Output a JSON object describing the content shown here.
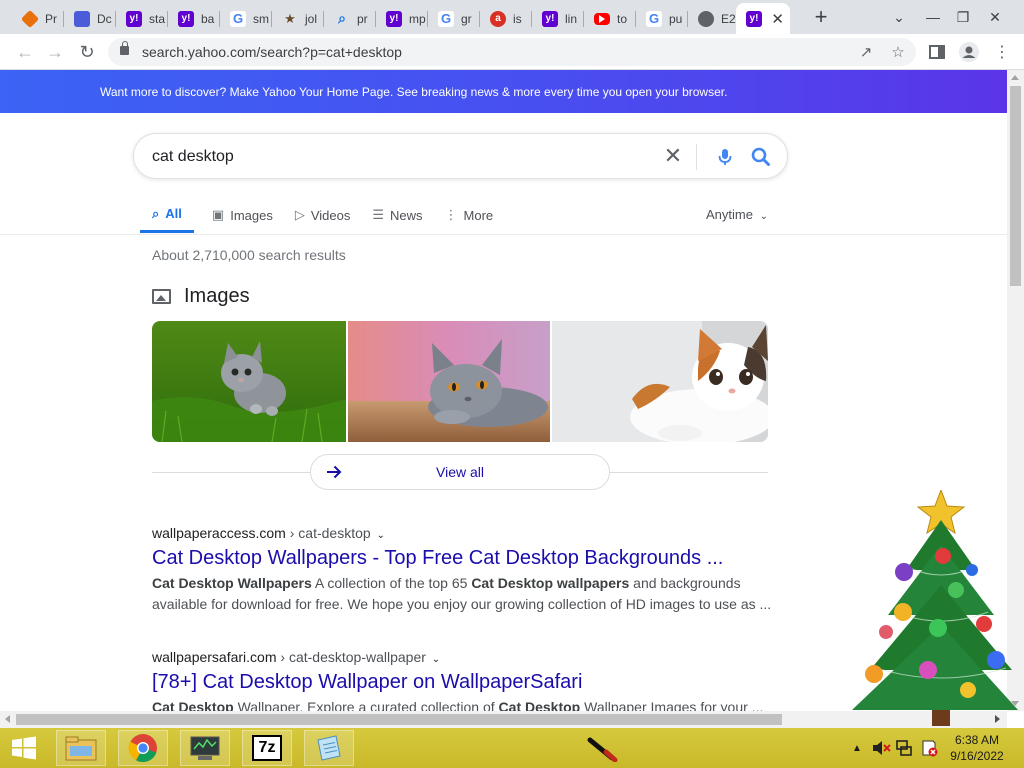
{
  "browser": {
    "tabs": [
      {
        "label": "Pr",
        "favicon": "diamond-icon",
        "color": "#e8710a"
      },
      {
        "label": "Dc",
        "favicon": "doc-icon",
        "color": "#4a5cd8"
      },
      {
        "label": "sta",
        "favicon": "yahoo-icon",
        "color": "#6001d2"
      },
      {
        "label": "ba",
        "favicon": "yahoo-icon",
        "color": "#6001d2"
      },
      {
        "label": "sm",
        "favicon": "google-icon",
        "color": "#4285f4"
      },
      {
        "label": "jol",
        "favicon": "person-icon",
        "color": "#6b4b2b"
      },
      {
        "label": "pr",
        "favicon": "search-icon",
        "color": "#1a73e8"
      },
      {
        "label": "mp",
        "favicon": "yahoo-icon",
        "color": "#6001d2"
      },
      {
        "label": "gr",
        "favicon": "google-icon",
        "color": "#4285f4"
      },
      {
        "label": "is",
        "favicon": "ask-icon",
        "color": "#d93025"
      },
      {
        "label": "lin",
        "favicon": "yahoo-icon",
        "color": "#6001d2"
      },
      {
        "label": "to",
        "favicon": "youtube-icon",
        "color": "#ff0000"
      },
      {
        "label": "pu",
        "favicon": "google-icon",
        "color": "#4285f4"
      },
      {
        "label": "E2",
        "favicon": "globe-icon",
        "color": "#5f6368"
      },
      {
        "label": "",
        "favicon": "yahoo-icon",
        "color": "#6001d2",
        "active": true
      }
    ],
    "url": "search.yahoo.com/search?p=cat+desktop"
  },
  "banner": {
    "text": "Want more to discover? Make Yahoo Your Home Page. See breaking news & more every time you open your browser."
  },
  "search": {
    "query": "cat desktop",
    "tabs": [
      {
        "label": "All",
        "icon": "search-icon",
        "active": true
      },
      {
        "label": "Images",
        "icon": "image-icon"
      },
      {
        "label": "Videos",
        "icon": "play-icon"
      },
      {
        "label": "News",
        "icon": "news-icon"
      },
      {
        "label": "More",
        "icon": "more-vert-icon"
      }
    ],
    "time_filter": "Anytime",
    "stats": "About 2,710,000 search results"
  },
  "images_section": {
    "heading": "Images",
    "view_all": "View all"
  },
  "results": [
    {
      "domain": "wallpaperaccess.com",
      "path": "› cat-desktop",
      "title": "Cat Desktop Wallpapers - Top Free Cat Desktop Backgrounds ...",
      "snippet": [
        {
          "t": "Cat Desktop Wallpapers",
          "b": true
        },
        {
          "t": " A collection of the top 65 "
        },
        {
          "t": "Cat Desktop",
          "b": true
        },
        {
          "t": " "
        },
        {
          "t": "wallpapers",
          "b": true
        },
        {
          "t": " and backgrounds available for download for free. We hope you enjoy our growing collection of HD images to use as ..."
        }
      ]
    },
    {
      "domain": "wallpapersafari.com",
      "path": "› cat-desktop-wallpaper",
      "title": "[78+] Cat Desktop Wallpaper on WallpaperSafari",
      "snippet": [
        {
          "t": "Cat Desktop",
          "b": true
        },
        {
          "t": " Wallpaper. Explore a curated collection of "
        },
        {
          "t": "Cat Desktop",
          "b": true
        },
        {
          "t": " Wallpaper Images for your ..."
        }
      ]
    }
  ],
  "taskbar": {
    "apps": [
      "file-explorer-icon",
      "chrome-icon",
      "system-monitor-icon",
      "7zip-icon",
      "notepad-icon"
    ],
    "sevenzip_label": "7z",
    "time": "6:38 AM",
    "date": "9/16/2022"
  }
}
